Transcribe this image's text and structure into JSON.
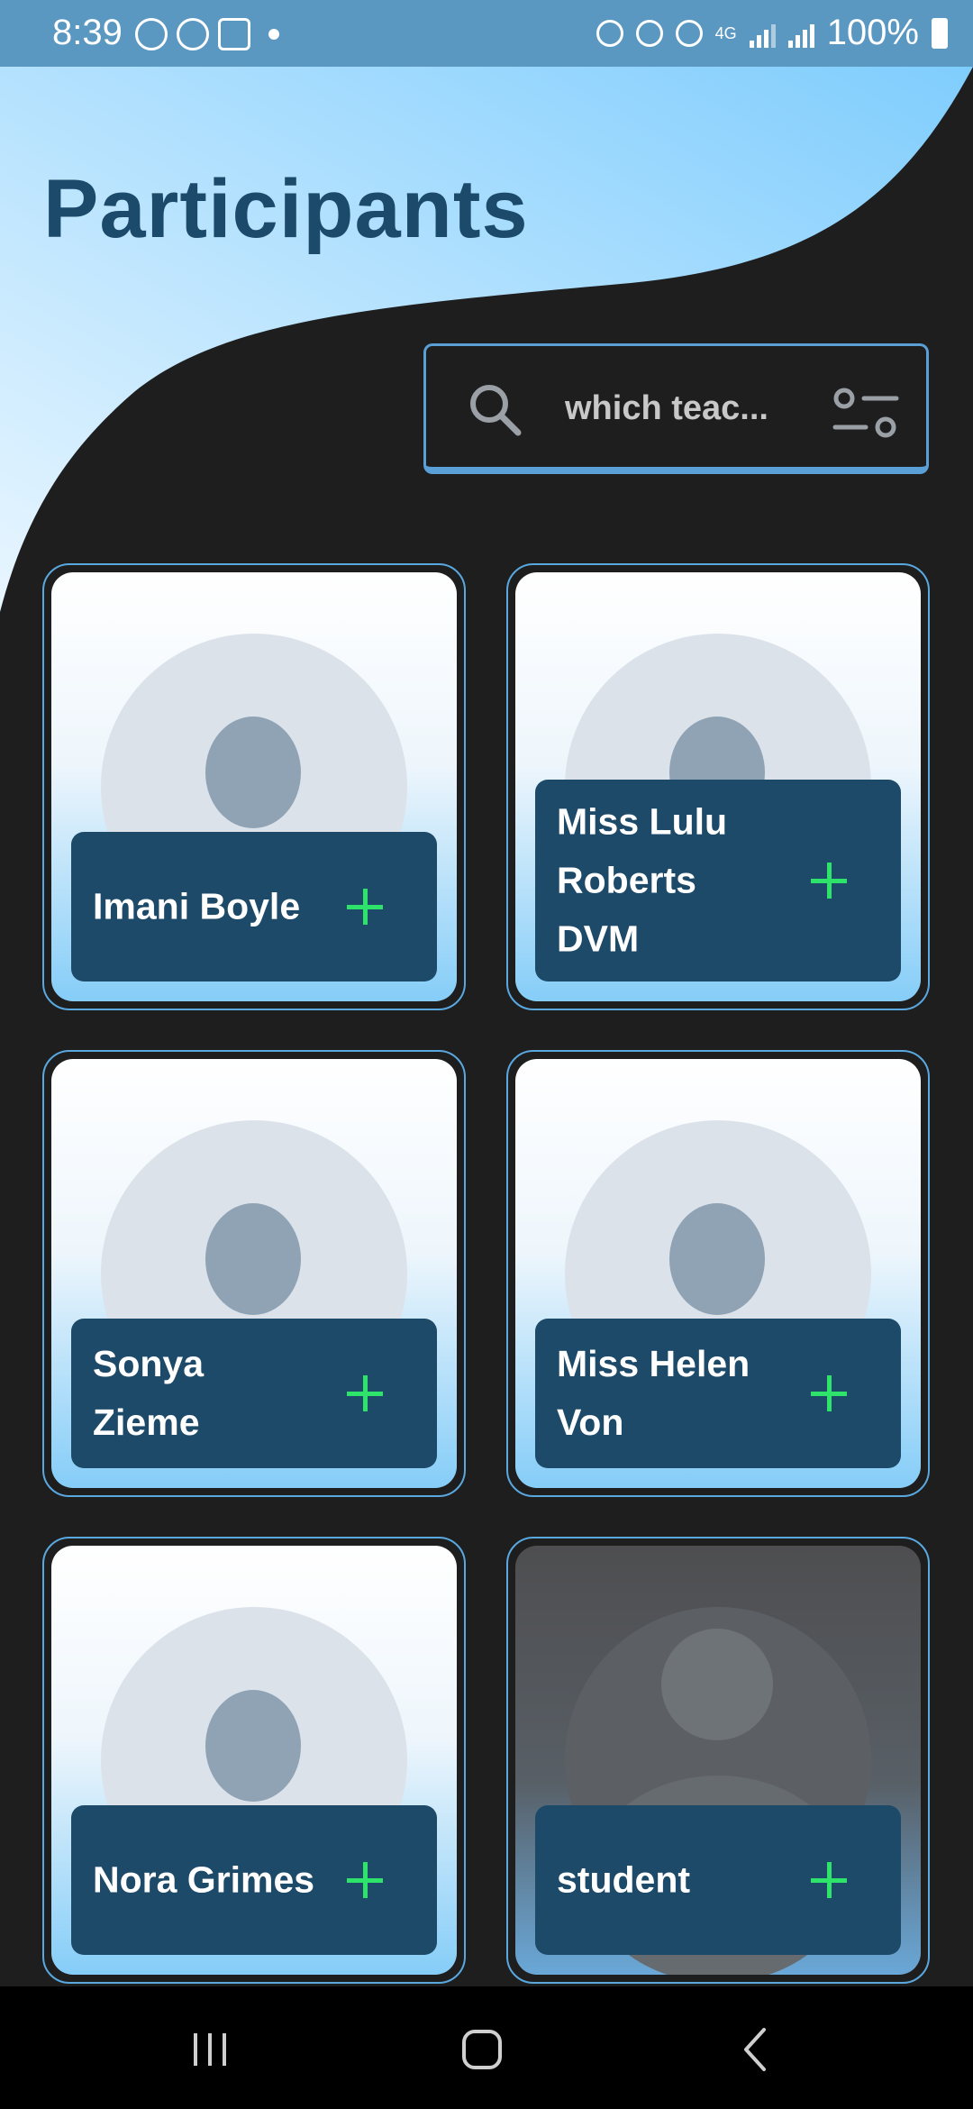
{
  "status_bar": {
    "time": "8:39",
    "network": "4G",
    "battery": "100%"
  },
  "page": {
    "title": "Participants"
  },
  "search": {
    "value": "which teac..."
  },
  "participants": [
    {
      "name": "Imani Boyle"
    },
    {
      "name": "Miss Lulu Roberts DVM"
    },
    {
      "name": "Sonya Zieme"
    },
    {
      "name": "Miss Helen Von"
    },
    {
      "name": "Nora Grimes"
    },
    {
      "name": "student"
    }
  ],
  "colors": {
    "title": "#1c4a6b",
    "card_border": "#5aa8e0",
    "name_panel": "#1c4a68",
    "add_icon": "#2ee36a",
    "background": "#1e1e1f",
    "header_gradient_start": "#e9f6ff",
    "header_gradient_end": "#7fcdfd"
  },
  "icons": {
    "search": "search-icon",
    "filter": "filter-icon",
    "add": "plus-icon",
    "nav_recents": "recents-icon",
    "nav_home": "home-icon",
    "nav_back": "back-icon"
  }
}
